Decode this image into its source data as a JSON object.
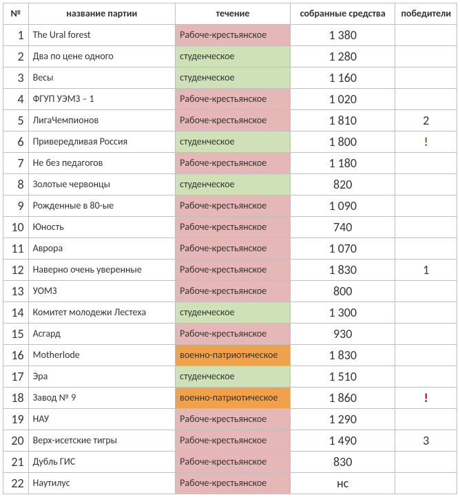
{
  "headers": {
    "num": "№",
    "party": "название партии",
    "trend": "течение",
    "funds": "собранные средства",
    "winners": "победители"
  },
  "trends": {
    "labor": "Рабоче-крестьянское",
    "student": "студенческое",
    "military": "военно-патриотическое"
  },
  "rows": [
    {
      "n": "1",
      "party": "The Ural forest",
      "trend": "labor",
      "funds": "1 380",
      "win": ""
    },
    {
      "n": "2",
      "party": "Два по цене одного",
      "trend": "student",
      "funds": "1 280",
      "win": ""
    },
    {
      "n": "3",
      "party": "Весы",
      "trend": "student",
      "funds": "1 160",
      "win": ""
    },
    {
      "n": "4",
      "party": "ФГУП  УЭМЗ – 1",
      "trend": "labor",
      "funds": "1 020",
      "win": ""
    },
    {
      "n": "5",
      "party": "ЛигаЧемпионов",
      "trend": "labor",
      "funds": "1 810",
      "win": "2"
    },
    {
      "n": "6",
      "party": "Привередливая Россия",
      "trend": "student",
      "funds": "1 800",
      "win": "!",
      "winCls": "win-exclg"
    },
    {
      "n": "7",
      "party": "Не без педагогов",
      "trend": "labor",
      "funds": "1 180",
      "win": ""
    },
    {
      "n": "8",
      "party": "Золотые червонцы",
      "trend": "student",
      "funds": "820",
      "win": ""
    },
    {
      "n": "9",
      "party": "Рожденные в 80-ые",
      "trend": "labor",
      "funds": "1 090",
      "win": ""
    },
    {
      "n": "10",
      "party": "Юность",
      "trend": "labor",
      "funds": "740",
      "win": ""
    },
    {
      "n": "11",
      "party": "Аврора",
      "trend": "labor",
      "funds": "1 070",
      "win": ""
    },
    {
      "n": "12",
      "party": "Наверно очень уверенные",
      "trend": "labor",
      "funds": "1 830",
      "win": "1"
    },
    {
      "n": "13",
      "party": "УОМЗ",
      "trend": "labor",
      "funds": "800",
      "win": ""
    },
    {
      "n": "14",
      "party": "Комитет молодежи Лестеха",
      "trend": "student",
      "funds": "1 300",
      "win": ""
    },
    {
      "n": "15",
      "party": "Асгард",
      "trend": "labor",
      "funds": "930",
      "win": ""
    },
    {
      "n": "16",
      "party": "Motherlode",
      "trend": "military",
      "funds": "1 830",
      "win": ""
    },
    {
      "n": "17",
      "party": "Эра",
      "trend": "student",
      "funds": "1 510",
      "win": ""
    },
    {
      "n": "18",
      "party": "Завод № 9",
      "trend": "military",
      "funds": "1 860",
      "win": "!",
      "winCls": "win-excl"
    },
    {
      "n": "19",
      "party": "НАУ",
      "trend": "labor",
      "funds": "1 290",
      "win": ""
    },
    {
      "n": "20",
      "party": "Верх-исетские тигры",
      "trend": "labor",
      "funds": "1 490",
      "win": "3"
    },
    {
      "n": "21",
      "party": "Дубль ГИС",
      "trend": "labor",
      "funds": "830",
      "win": ""
    },
    {
      "n": "22",
      "party": "Наутилус",
      "trend": "labor",
      "funds": "нс",
      "win": ""
    }
  ]
}
